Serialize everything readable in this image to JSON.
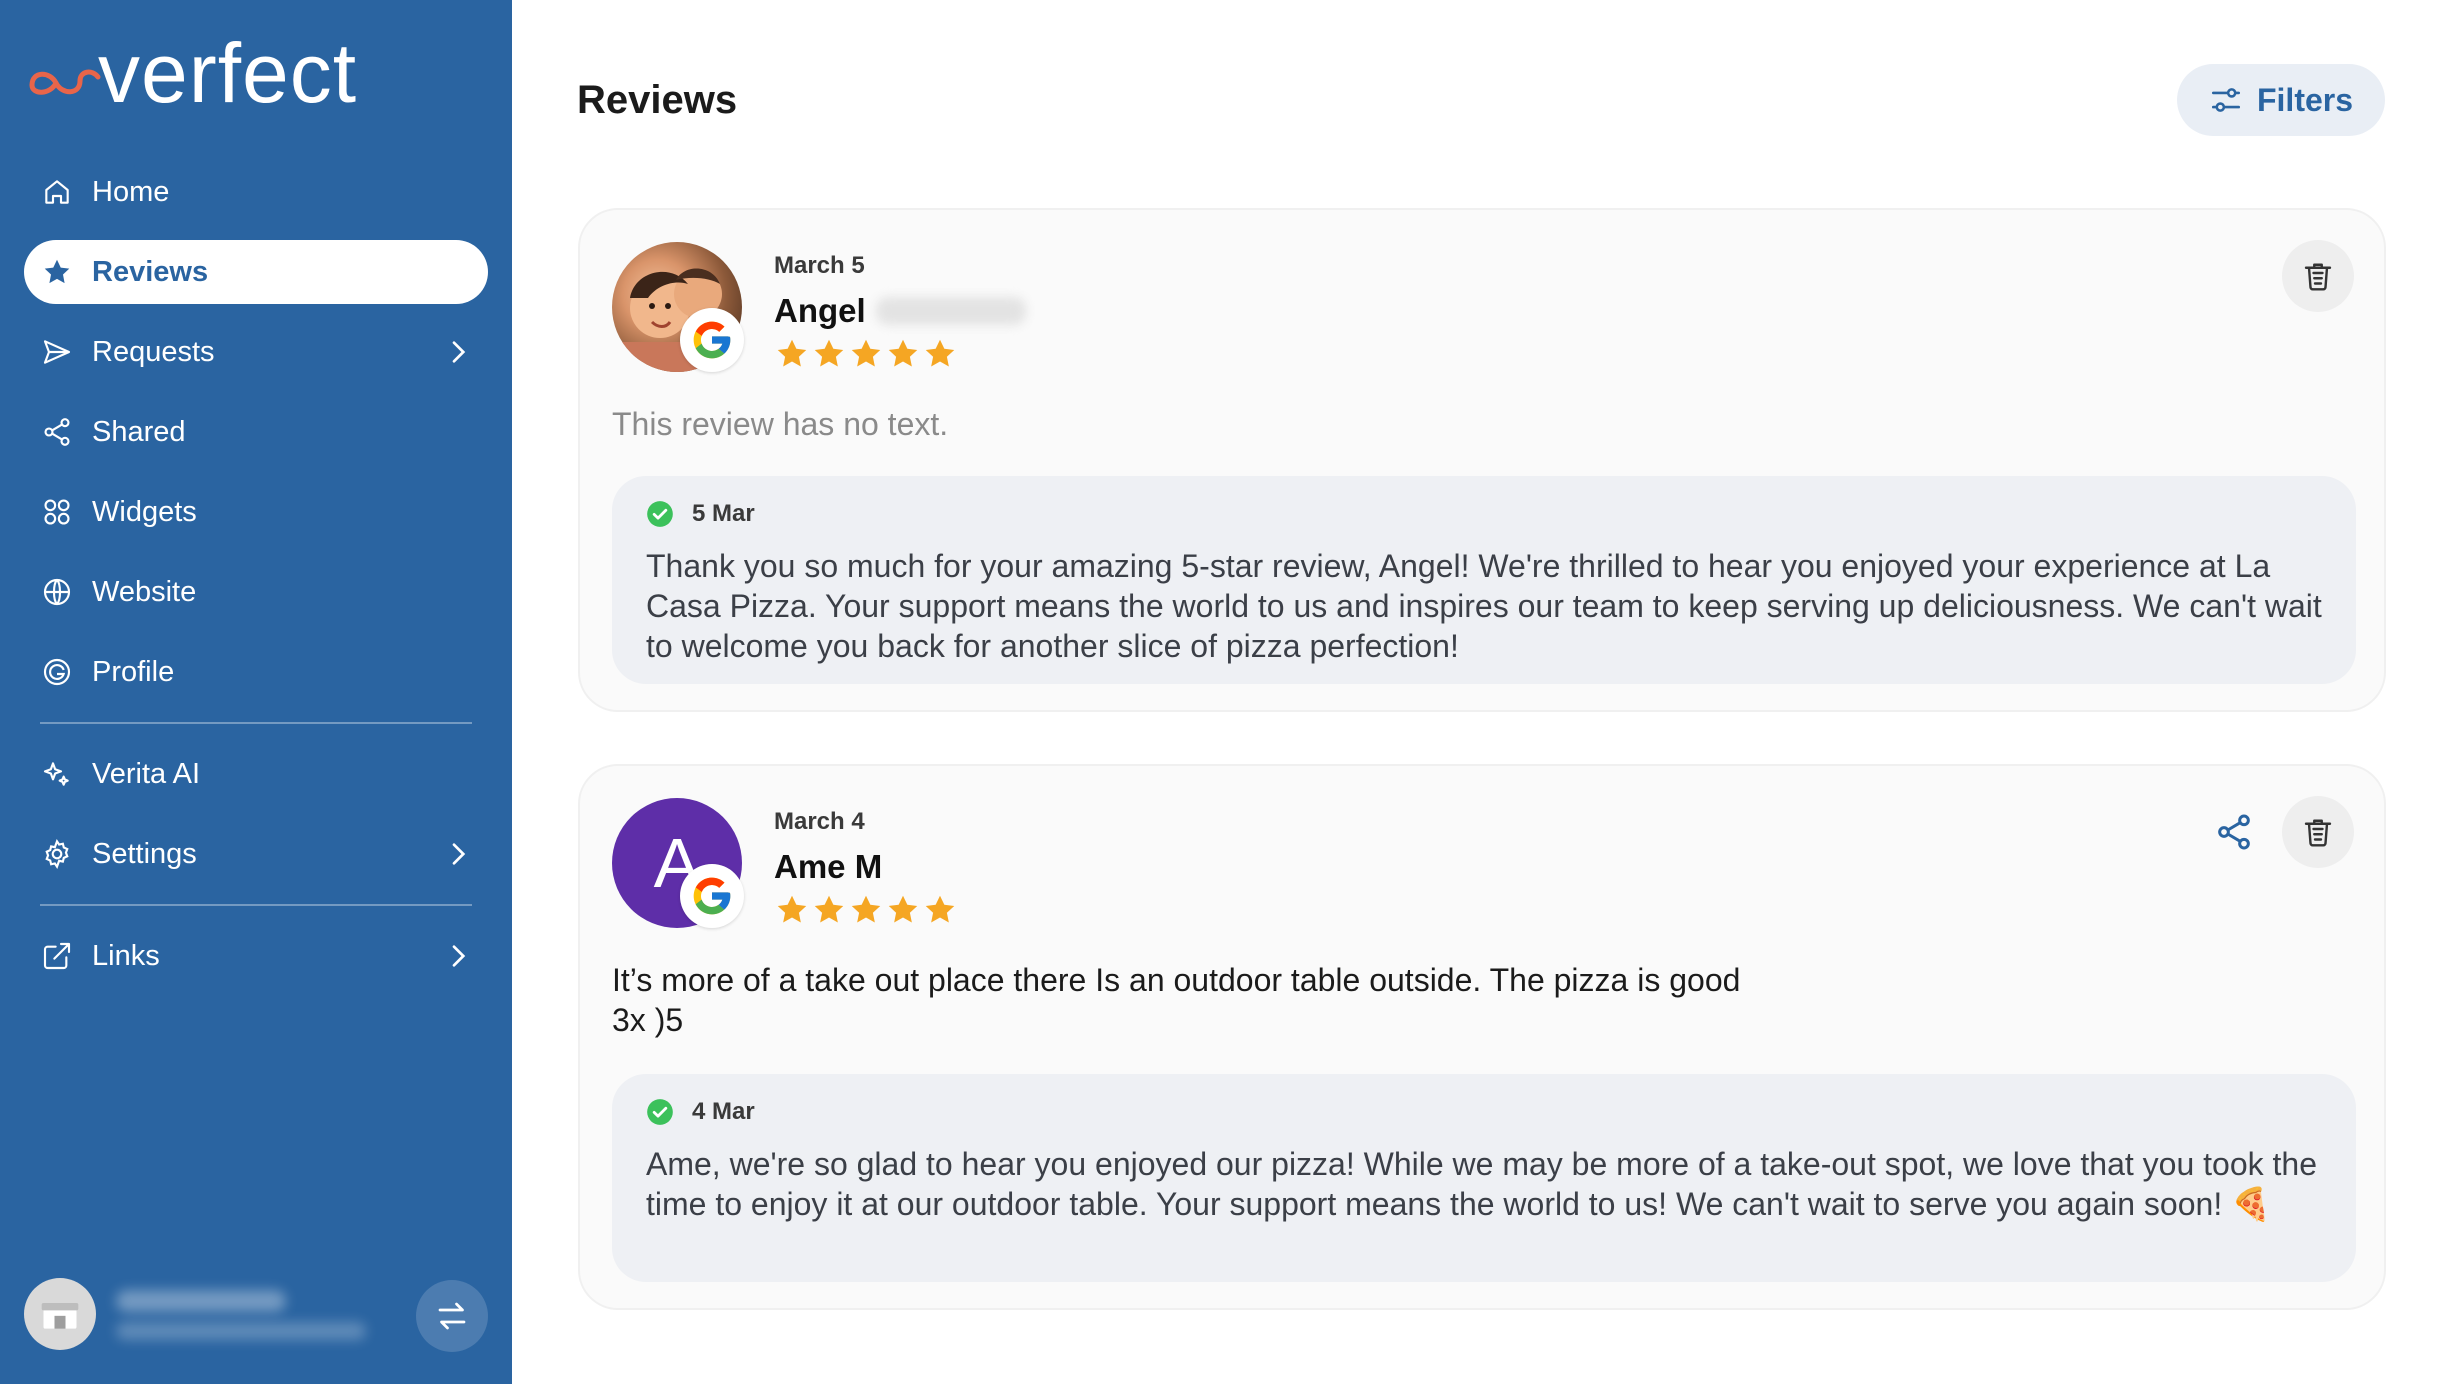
{
  "brand": {
    "logo_text": "verfect",
    "primary_color": "#2a64a1",
    "accent_color": "#e8654a"
  },
  "sidebar": {
    "items": [
      {
        "label": "Home",
        "icon": "home-icon",
        "active": false,
        "has_submenu": false
      },
      {
        "label": "Reviews",
        "icon": "star-icon",
        "active": true,
        "has_submenu": false
      },
      {
        "label": "Requests",
        "icon": "send-icon",
        "active": false,
        "has_submenu": true
      },
      {
        "label": "Shared",
        "icon": "share-icon",
        "active": false,
        "has_submenu": false
      },
      {
        "label": "Widgets",
        "icon": "widgets-icon",
        "active": false,
        "has_submenu": false
      },
      {
        "label": "Website",
        "icon": "globe-icon",
        "active": false,
        "has_submenu": false
      },
      {
        "label": "Profile",
        "icon": "google-icon",
        "active": false,
        "has_submenu": false
      },
      {
        "label": "Verita AI",
        "icon": "sparkle-icon",
        "active": false,
        "has_submenu": false
      },
      {
        "label": "Settings",
        "icon": "gear-icon",
        "active": false,
        "has_submenu": true
      },
      {
        "label": "Links",
        "icon": "external-link-icon",
        "active": false,
        "has_submenu": true
      }
    ]
  },
  "header": {
    "title": "Reviews",
    "filters_label": "Filters"
  },
  "reviews": [
    {
      "date": "March 5",
      "reviewer": "Angel",
      "rating": 5,
      "source": "google",
      "text": "This review has no text.",
      "reply": {
        "date": "5 Mar",
        "text": "Thank you so much for your amazing 5-star review, Angel! We're thrilled to hear you enjoyed your experience at La Casa Pizza. Your support means the world to us and inspires our team to keep serving up deliciousness. We can't wait to welcome you back for another slice of pizza perfection!"
      }
    },
    {
      "date": "March 4",
      "reviewer": "Ame M",
      "avatar_letter": "A",
      "rating": 5,
      "source": "google",
      "text": "It’s more of a take out place there Is an outdoor table outside. The pizza is good\n3x )5",
      "reply": {
        "date": "4 Mar",
        "text": "Ame, we're so glad to hear you enjoyed our pizza! While we may be more of a take-out spot, we love that you took the time to enjoy it at our outdoor table. Your support means the world to us! We can't wait to serve you again soon! 🍕"
      }
    }
  ]
}
